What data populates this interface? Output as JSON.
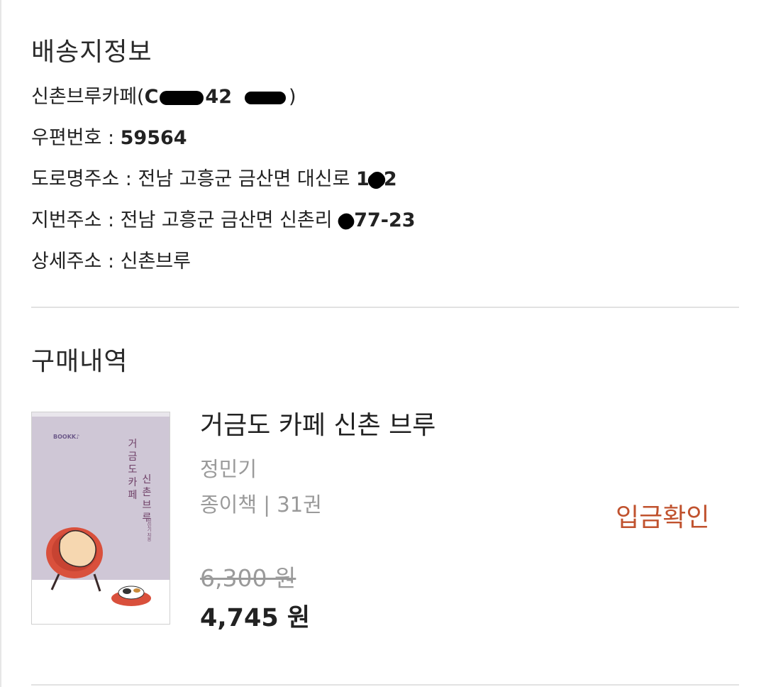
{
  "shipping": {
    "title": "배송지정보",
    "name_line": "신촌브루카페(",
    "phone_visible_a": "C",
    "phone_visible_b": "42",
    "phone_visible_c": ")",
    "postal_label": "우편번호 : ",
    "postal_value": "59564",
    "road_label": "도로명주소 : 전남 고흥군 금산면 대신로 ",
    "road_num_a": "1",
    "road_num_b": "2",
    "lot_label": "지번주소 : 전남 고흥군 금산면 신촌리 ",
    "lot_num": "77-23",
    "detail_label": "상세주소 : 신촌브루"
  },
  "purchase": {
    "title": "구매내역",
    "item": {
      "cover_logo": "BOOKK♪",
      "cover_title_a": "거금도 카페",
      "cover_title_b": "신촌 브루",
      "cover_author": "정민기 지음",
      "title": "거금도 카페 신촌 브루",
      "author": "정민기",
      "format": "종이책 | 31권",
      "status": "입금확인",
      "status_color": "#c0522e",
      "price_original": "6,300 원",
      "price_final": "4,745 원"
    }
  }
}
